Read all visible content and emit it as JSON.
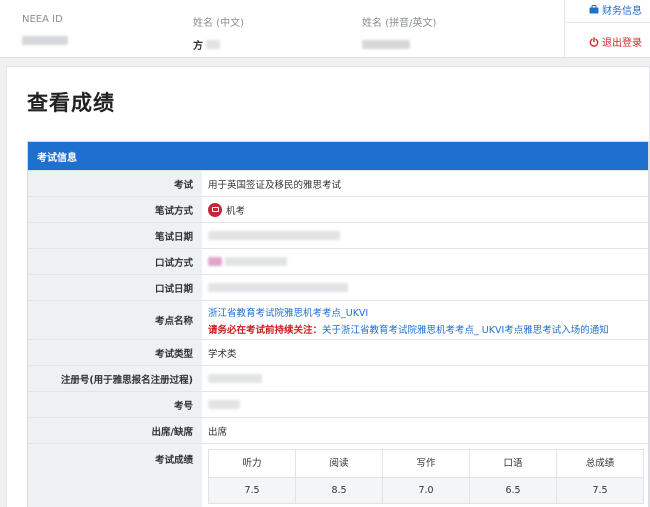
{
  "header": {
    "neea_id_label": "NEEA ID",
    "name_cn_label": "姓名 (中文)",
    "name_cn_value": "方",
    "name_en_label": "姓名 (拼音/英文)",
    "finance_link": "财务信息",
    "logout_link": "退出登录"
  },
  "page": {
    "title": "查看成绩"
  },
  "exam_info": {
    "section_title": "考试信息",
    "rows": {
      "exam": {
        "label": "考试",
        "value": "用于英国签证及移民的雅思考试"
      },
      "written_mode": {
        "label": "笔试方式",
        "value": "机考"
      },
      "written_date": {
        "label": "笔试日期"
      },
      "speaking_mode": {
        "label": "口试方式"
      },
      "speaking_date": {
        "label": "口试日期"
      },
      "center": {
        "label": "考点名称",
        "name": "浙江省教育考试院雅思机考考点_UKVI",
        "notice_prefix": "请务必在考试前持续关注：",
        "notice_link": "关于浙江省教育考试院雅思机考考点_ UKVI考点雅思考试入场的通知"
      },
      "exam_type": {
        "label": "考试类型",
        "value": "学术类"
      },
      "registration": {
        "label": "注册号(用于雅思报名注册过程)"
      },
      "candidate_no": {
        "label": "考号"
      },
      "attendance": {
        "label": "出席/缺席",
        "value": "出席"
      },
      "scores_label": "考试成绩"
    },
    "scores": {
      "headers": [
        "听力",
        "阅读",
        "写作",
        "口语",
        "总成绩"
      ],
      "values": [
        "7.5",
        "8.5",
        "7.0",
        "6.5",
        "7.5"
      ]
    }
  },
  "colors": {
    "accent": "#1e6fd0",
    "danger": "#cc1f1f",
    "label_bg": "#eef1f4"
  },
  "icons": {
    "finance": "briefcase-icon",
    "logout": "power-icon",
    "exam_mode": "computer-icon"
  }
}
